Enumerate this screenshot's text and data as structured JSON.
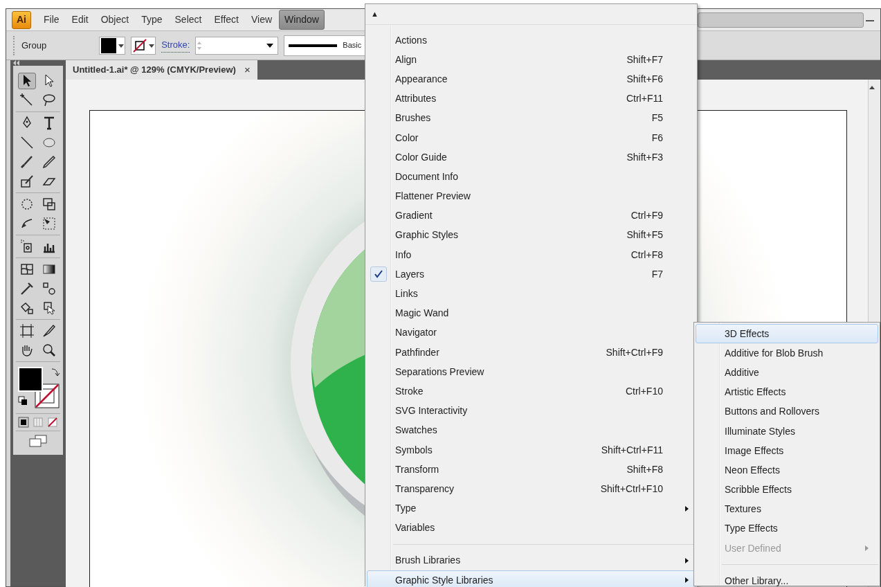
{
  "app": {
    "logo": "Ai"
  },
  "menubar": [
    {
      "label": "File",
      "selected": false
    },
    {
      "label": "Edit",
      "selected": false
    },
    {
      "label": "Object",
      "selected": false
    },
    {
      "label": "Type",
      "selected": false
    },
    {
      "label": "Select",
      "selected": false
    },
    {
      "label": "Effect",
      "selected": false
    },
    {
      "label": "View",
      "selected": false
    },
    {
      "label": "Window",
      "selected": true
    }
  ],
  "control_bar": {
    "selection": "Group",
    "stroke_label": "Stroke:",
    "brush": "Basic"
  },
  "document_tab": {
    "title": "Untitled-1.ai* @ 129% (CMYK/Preview)",
    "close": "×"
  },
  "window_menu": {
    "scroll_up": "▲",
    "items": [
      {
        "kind": "item",
        "label": "Actions",
        "checked": false,
        "submenu": false,
        "selected": false
      },
      {
        "kind": "item",
        "label": "Align",
        "shortcut": "Shift+F7",
        "checked": false,
        "submenu": false,
        "selected": false
      },
      {
        "kind": "item",
        "label": "Appearance",
        "shortcut": "Shift+F6",
        "checked": false,
        "submenu": false,
        "selected": false
      },
      {
        "kind": "item",
        "label": "Attributes",
        "shortcut": "Ctrl+F11",
        "checked": false,
        "submenu": false,
        "selected": false
      },
      {
        "kind": "item",
        "label": "Brushes",
        "shortcut": "F5",
        "checked": false,
        "submenu": false,
        "selected": false
      },
      {
        "kind": "item",
        "label": "Color",
        "shortcut": "F6",
        "checked": false,
        "submenu": false,
        "selected": false
      },
      {
        "kind": "item",
        "label": "Color Guide",
        "shortcut": "Shift+F3",
        "checked": false,
        "submenu": false,
        "selected": false
      },
      {
        "kind": "item",
        "label": "Document Info",
        "checked": false,
        "submenu": false,
        "selected": false
      },
      {
        "kind": "item",
        "label": "Flattener Preview",
        "checked": false,
        "submenu": false,
        "selected": false
      },
      {
        "kind": "item",
        "label": "Gradient",
        "shortcut": "Ctrl+F9",
        "checked": false,
        "submenu": false,
        "selected": false
      },
      {
        "kind": "item",
        "label": "Graphic Styles",
        "shortcut": "Shift+F5",
        "checked": false,
        "submenu": false,
        "selected": false
      },
      {
        "kind": "item",
        "label": "Info",
        "shortcut": "Ctrl+F8",
        "checked": false,
        "submenu": false,
        "selected": false
      },
      {
        "kind": "item",
        "label": "Layers",
        "shortcut": "F7",
        "checked": true,
        "submenu": false,
        "selected": false
      },
      {
        "kind": "item",
        "label": "Links",
        "checked": false,
        "submenu": false,
        "selected": false
      },
      {
        "kind": "item",
        "label": "Magic Wand",
        "checked": false,
        "submenu": false,
        "selected": false
      },
      {
        "kind": "item",
        "label": "Navigator",
        "checked": false,
        "submenu": false,
        "selected": false
      },
      {
        "kind": "item",
        "label": "Pathfinder",
        "shortcut": "Shift+Ctrl+F9",
        "checked": false,
        "submenu": false,
        "selected": false
      },
      {
        "kind": "item",
        "label": "Separations Preview",
        "checked": false,
        "submenu": false,
        "selected": false
      },
      {
        "kind": "item",
        "label": "Stroke",
        "shortcut": "Ctrl+F10",
        "checked": false,
        "submenu": false,
        "selected": false
      },
      {
        "kind": "item",
        "label": "SVG Interactivity",
        "checked": false,
        "submenu": false,
        "selected": false
      },
      {
        "kind": "item",
        "label": "Swatches",
        "checked": false,
        "submenu": false,
        "selected": false
      },
      {
        "kind": "item",
        "label": "Symbols",
        "shortcut": "Shift+Ctrl+F11",
        "checked": false,
        "submenu": false,
        "selected": false
      },
      {
        "kind": "item",
        "label": "Transform",
        "shortcut": "Shift+F8",
        "checked": false,
        "submenu": false,
        "selected": false
      },
      {
        "kind": "item",
        "label": "Transparency",
        "shortcut": "Shift+Ctrl+F10",
        "checked": false,
        "submenu": false,
        "selected": false
      },
      {
        "kind": "item",
        "label": "Type",
        "checked": false,
        "submenu": true,
        "selected": false
      },
      {
        "kind": "item",
        "label": "Variables",
        "checked": false,
        "submenu": false,
        "selected": false
      },
      {
        "kind": "separator"
      },
      {
        "kind": "item",
        "label": "Brush Libraries",
        "checked": false,
        "submenu": true,
        "selected": false
      },
      {
        "kind": "item",
        "label": "Graphic Style Libraries",
        "checked": false,
        "submenu": true,
        "selected": true
      }
    ]
  },
  "submenu": {
    "items": [
      {
        "kind": "item",
        "label": "3D Effects",
        "selected": true,
        "disabled": false,
        "submenu": false
      },
      {
        "kind": "item",
        "label": "Additive for Blob Brush",
        "selected": false,
        "disabled": false,
        "submenu": false
      },
      {
        "kind": "item",
        "label": "Additive",
        "selected": false,
        "disabled": false,
        "submenu": false
      },
      {
        "kind": "item",
        "label": "Artistic Effects",
        "selected": false,
        "disabled": false,
        "submenu": false
      },
      {
        "kind": "item",
        "label": "Buttons and Rollovers",
        "selected": false,
        "disabled": false,
        "submenu": false
      },
      {
        "kind": "item",
        "label": "Illuminate Styles",
        "selected": false,
        "disabled": false,
        "submenu": false
      },
      {
        "kind": "item",
        "label": "Image Effects",
        "selected": false,
        "disabled": false,
        "submenu": false
      },
      {
        "kind": "item",
        "label": "Neon Effects",
        "selected": false,
        "disabled": false,
        "submenu": false
      },
      {
        "kind": "item",
        "label": "Scribble Effects",
        "selected": false,
        "disabled": false,
        "submenu": false
      },
      {
        "kind": "item",
        "label": "Textures",
        "selected": false,
        "disabled": false,
        "submenu": false
      },
      {
        "kind": "item",
        "label": "Type Effects",
        "selected": false,
        "disabled": false,
        "submenu": false
      },
      {
        "kind": "item",
        "label": "User Defined",
        "selected": false,
        "disabled": true,
        "submenu": true
      },
      {
        "kind": "separator"
      },
      {
        "kind": "item",
        "label": "Other Library...",
        "selected": false,
        "disabled": false,
        "submenu": false
      }
    ]
  }
}
